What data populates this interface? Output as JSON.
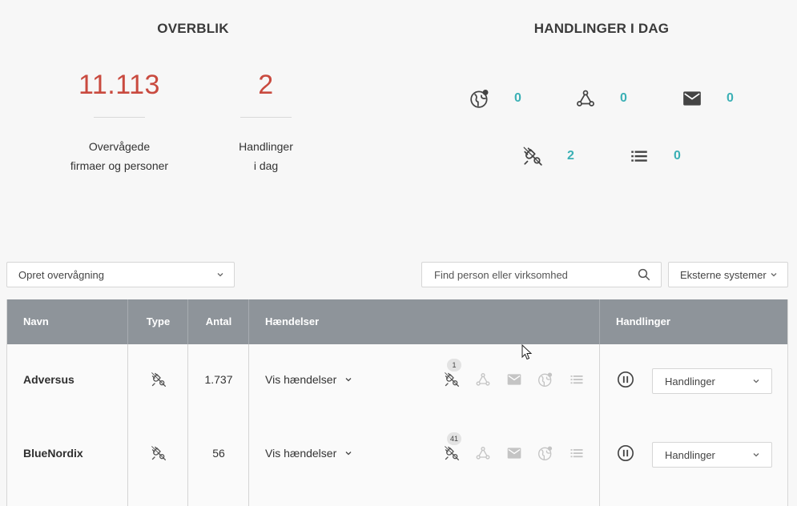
{
  "overview": {
    "title": "OVERBLIK",
    "monitored": {
      "value": "11.113",
      "label_line1": "Overvågede",
      "label_line2": "firmaer og personer"
    },
    "actions": {
      "value": "2",
      "label_line1": "Handlinger",
      "label_line2": "i dag"
    }
  },
  "today": {
    "title": "HANDLINGER I DAG",
    "items": [
      {
        "icon": "globe-alert-icon",
        "count": "0"
      },
      {
        "icon": "webhook-icon",
        "count": "0"
      },
      {
        "icon": "mail-icon",
        "count": "0"
      },
      {
        "icon": "plug-search-icon",
        "count": "2"
      },
      {
        "icon": "list-icon",
        "count": "0"
      }
    ]
  },
  "controls": {
    "create": "Opret overvågning",
    "search_placeholder": "Find person eller virksomhed",
    "external": "Eksterne systemer"
  },
  "table": {
    "headers": {
      "name": "Navn",
      "type": "Type",
      "count": "Antal",
      "events": "Hændelser",
      "actions": "Handlinger"
    },
    "rows": [
      {
        "name": "Adversus",
        "type_icon": "plug-search-icon",
        "count": "1.737",
        "events_label": "Vis hændelser",
        "badge": "1",
        "action_label": "Handlinger"
      },
      {
        "name": "BlueNordix",
        "type_icon": "plug-search-icon",
        "count": "56",
        "events_label": "Vis hændelser",
        "badge": "41",
        "action_label": "Handlinger"
      }
    ]
  },
  "colors": {
    "accent_red": "#c94a3f",
    "accent_teal": "#3bb0b5",
    "header_gray": "#8e949a"
  }
}
